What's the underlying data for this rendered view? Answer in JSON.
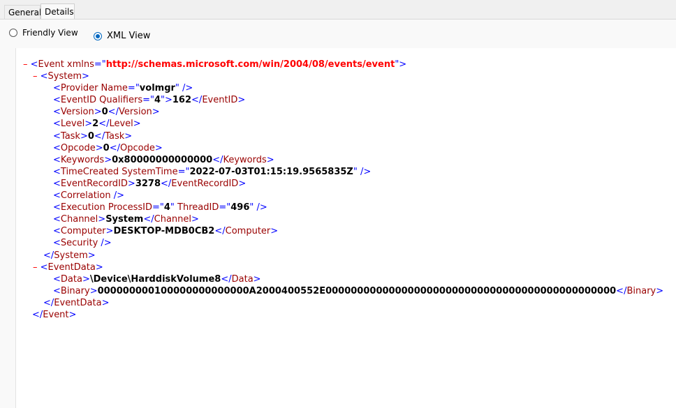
{
  "tabs": [
    {
      "label": "General"
    },
    {
      "label": "Details"
    }
  ],
  "view_options": {
    "friendly": "Friendly View",
    "xml": "XML View",
    "selected": "XML View"
  },
  "xml": {
    "event_open": "<Event xmlns=",
    "event_ns": "http://schemas.microsoft.com/win/2004/08/events/event",
    "system_open": "<System>",
    "provider_name": "volmgr",
    "event_id_qualifiers": "4",
    "event_id": "162",
    "version": "0",
    "level": "2",
    "task": "0",
    "opcode": "0",
    "keywords": "0x80000000000000",
    "time_created": "2022-07-03T01:15:19.9565835Z",
    "event_record_id": "3278",
    "process_id": "4",
    "thread_id": "496",
    "channel": "System",
    "computer": "DESKTOP-MDB0CB2",
    "data": "\\Device\\HarddiskVolume8",
    "binary": "000000000100000000000000A2000400552E0000000000000000000000000000000000000000000000"
  },
  "colors": {
    "tag": "#990000",
    "bracket": "#0000ff",
    "namespace": "#ff0000",
    "radio_accent": "#0067c0"
  }
}
